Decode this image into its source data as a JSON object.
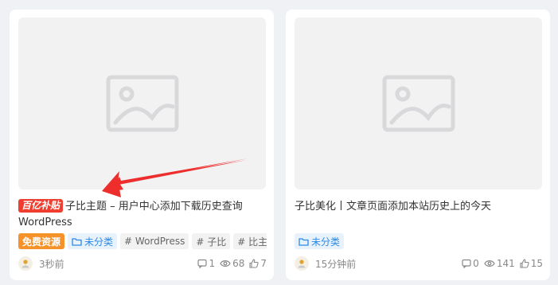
{
  "cards": [
    {
      "brand_badge": "百亿补贴",
      "title": "子比主题 – 用户中心添加下载历史查询WordPress",
      "tags": {
        "free": "免费资源",
        "category": "未分类",
        "hash1": "# WordPress",
        "hash2": "# 子比",
        "hash3": "# 比主"
      },
      "meta": {
        "time": "3秒前",
        "comments": "1",
        "views": "68",
        "likes": "7"
      }
    },
    {
      "title": "子比美化丨文章页面添加本站历史上的今天",
      "tags": {
        "category": "未分类"
      },
      "meta": {
        "time": "15分钟前",
        "comments": "0",
        "views": "141",
        "likes": "15"
      }
    }
  ],
  "colors": {
    "accent": "#2d8ae5",
    "free_badge": "#f5932a",
    "brand_badge": "#ef3e2f",
    "arrow": "#ee2d2d"
  },
  "icons": [
    "image-placeholder-icon",
    "folder-icon",
    "comment-icon",
    "eye-icon",
    "thumbs-up-icon",
    "avatar-icon"
  ]
}
